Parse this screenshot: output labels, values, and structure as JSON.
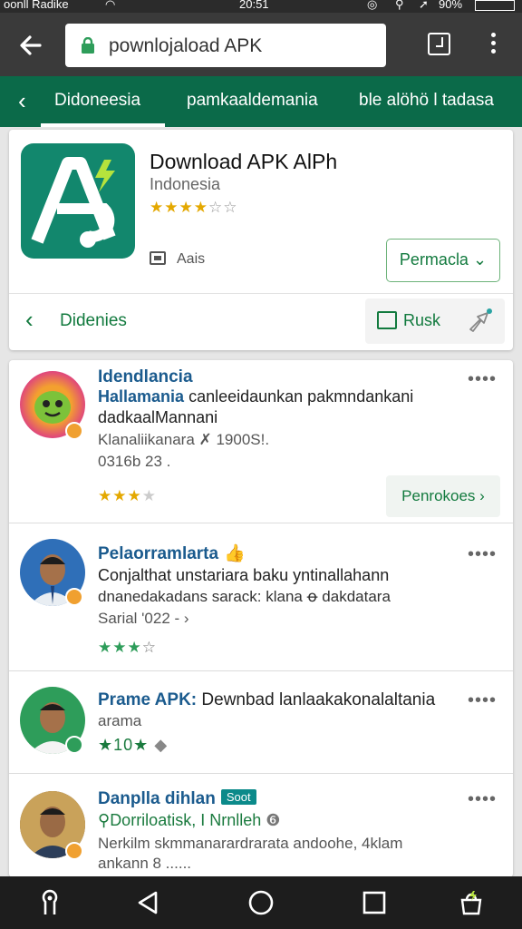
{
  "status_bar": {
    "carrier": "oonll Radike",
    "time": "20:51",
    "battery": "90%"
  },
  "browser": {
    "url": "pownlojaload APK"
  },
  "tabbar": {
    "tabs": [
      {
        "label": "Didoneesia"
      },
      {
        "label": "pamkaaldemania"
      },
      {
        "label": "ble alöhö l tadasa"
      }
    ]
  },
  "app": {
    "title": "Download APK AlPh",
    "subtitle": "Indonesia",
    "rating_stars": "★★★★",
    "rating_empty": "☆☆",
    "meta_label": "Aais",
    "download_button": "Permacla",
    "nav_label": "Didenies",
    "rusk_button": "Rusk"
  },
  "reviews": [
    {
      "title": "Idendlancia",
      "line_prefix": "Hallamania",
      "line1": "canleeidaunkan pakmndankani",
      "line2": "dadkaalMannani",
      "meta1": "Klanaliikanara ✗ 1900S!.",
      "meta2": "0316b 23 .",
      "stars_on": "★★★",
      "stars_off": "★",
      "button": "Penrokoes"
    },
    {
      "title": "Pelaorramlarta",
      "line1": "Conjalthat unstariara baku yntinallahann",
      "line2": "dnanedakadans sarack: klana ꝋ dakdatara",
      "meta1": "Sarial '022 - ›",
      "stars_on": "★★★",
      "stars_off": "☆"
    },
    {
      "title": "Prame APK:",
      "title_rest": "Dewnbad lanlaakakonalaltania",
      "line1": "arama",
      "rating": "★10★"
    },
    {
      "title": "Danplla dihlan",
      "tag": "Soot",
      "line1": "Dorriloatisk, I Nrnlleh",
      "line2": "Nerkilm skmmanarardrarata andoohe, 4klam",
      "line3": "ankann 8 ......"
    }
  ],
  "colors": {
    "brand_green": "#0b6a49",
    "accent_green": "#127a3e",
    "star_gold": "#e4a800",
    "title_blue": "#1b5b8e"
  }
}
